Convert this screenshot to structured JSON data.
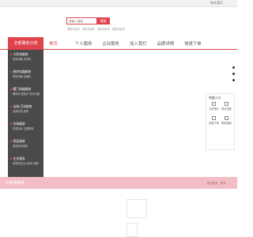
{
  "top_bar": {
    "link": "联系我们"
  },
  "search": {
    "placeholder": "请输入搜索",
    "button_label": "搜索",
    "hot_words": [
      "搜索关键词",
      "搜索关键词",
      "搜索关键词",
      "搜索关键词"
    ]
  },
  "category_header": "全部服务分类",
  "nav": {
    "items": [
      {
        "label": "首页",
        "active": true
      },
      {
        "label": "个人服务",
        "active": false
      },
      {
        "label": "企业服务",
        "active": false
      },
      {
        "label": "加入我们",
        "active": false
      },
      {
        "label": "品牌详情",
        "active": false
      },
      {
        "label": "快速下单",
        "active": false
      }
    ]
  },
  "categories": [
    {
      "title": "大家电维修",
      "sub": "家用电器 洗衣机"
    },
    {
      "title": "厨房电器维修",
      "sub": "厨房电器 油烟机"
    },
    {
      "title": "暖门电器维修",
      "sub": "暖风机 壁挂炉 电热水器"
    },
    {
      "title": "洁具/卫浴维修",
      "sub": "浴霸安装 维修"
    },
    {
      "title": "空调维修",
      "sub": "空调加氟 空调移机"
    },
    {
      "title": "家居维修",
      "sub": "家居家具维修"
    },
    {
      "title": "企业服务",
      "sub": "家居修复办公家具 维修"
    }
  ],
  "float_panel": {
    "title": "快速入口",
    "items": [
      {
        "label": "立即预约"
      },
      {
        "label": "预约进度"
      },
      {
        "label": "快速下单"
      },
      {
        "label": "联系客服"
      }
    ]
  },
  "banner": {
    "title": "大家电维修",
    "more_1": "更多服务",
    "more_2": "更多"
  },
  "colors": {
    "accent": "#e0434d",
    "sidebar": "#4a4a4a",
    "banner": "#f2bdc4"
  }
}
